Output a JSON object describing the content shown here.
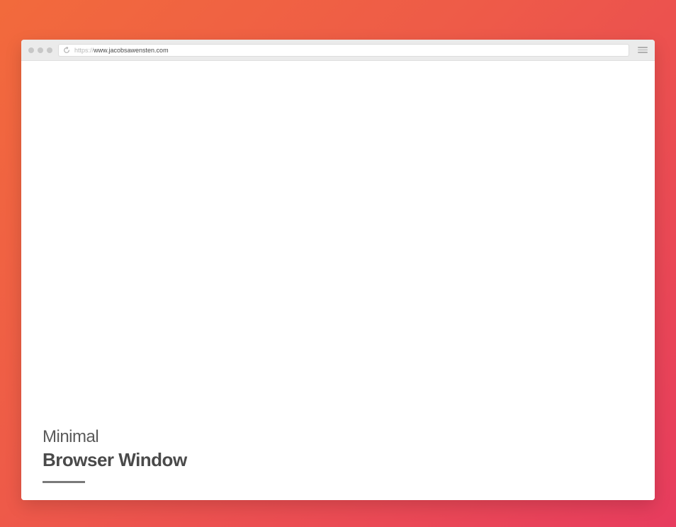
{
  "browser": {
    "url": {
      "protocol": "https://",
      "domain": "www.jacobsawensten.com"
    }
  },
  "content": {
    "title_line1": "Minimal",
    "title_line2": "Browser Window"
  }
}
